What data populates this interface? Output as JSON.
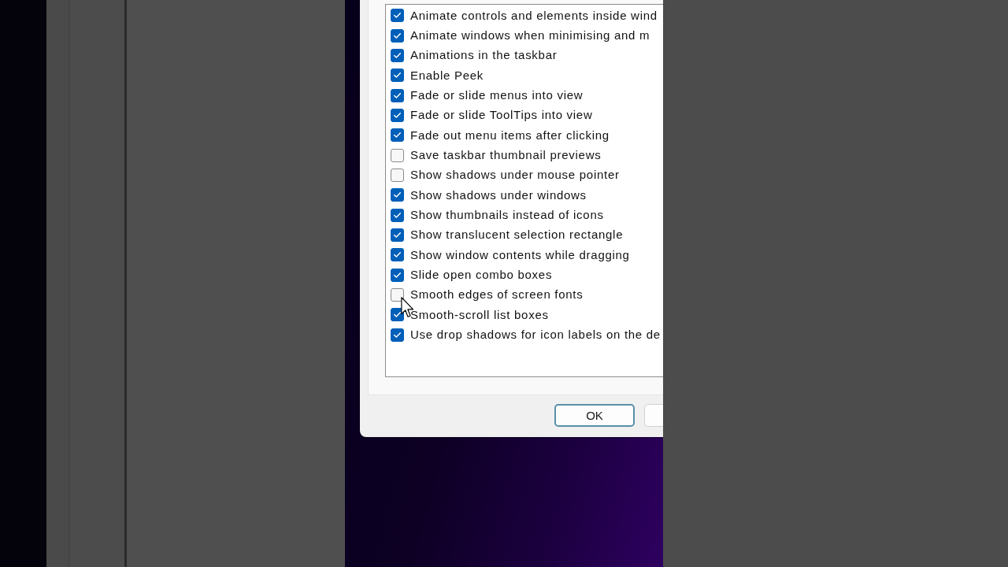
{
  "options": [
    {
      "label": "Animate controls and elements inside wind",
      "checked": true
    },
    {
      "label": "Animate windows when minimising and m",
      "checked": true
    },
    {
      "label": "Animations in the taskbar",
      "checked": true
    },
    {
      "label": "Enable Peek",
      "checked": true
    },
    {
      "label": "Fade or slide menus into view",
      "checked": true
    },
    {
      "label": "Fade or slide ToolTips into view",
      "checked": true
    },
    {
      "label": "Fade out menu items after clicking",
      "checked": true
    },
    {
      "label": "Save taskbar thumbnail previews",
      "checked": false
    },
    {
      "label": "Show shadows under mouse pointer",
      "checked": false
    },
    {
      "label": "Show shadows under windows",
      "checked": true
    },
    {
      "label": "Show thumbnails instead of icons",
      "checked": true
    },
    {
      "label": "Show translucent selection rectangle",
      "checked": true
    },
    {
      "label": "Show window contents while dragging",
      "checked": true
    },
    {
      "label": "Slide open combo boxes",
      "checked": true
    },
    {
      "label": "Smooth edges of screen fonts",
      "checked": false
    },
    {
      "label": "Smooth-scroll list boxes",
      "checked": true
    },
    {
      "label": "Use drop shadows for icon labels on the de",
      "checked": true
    }
  ],
  "buttons": [
    {
      "label": "OK"
    }
  ]
}
